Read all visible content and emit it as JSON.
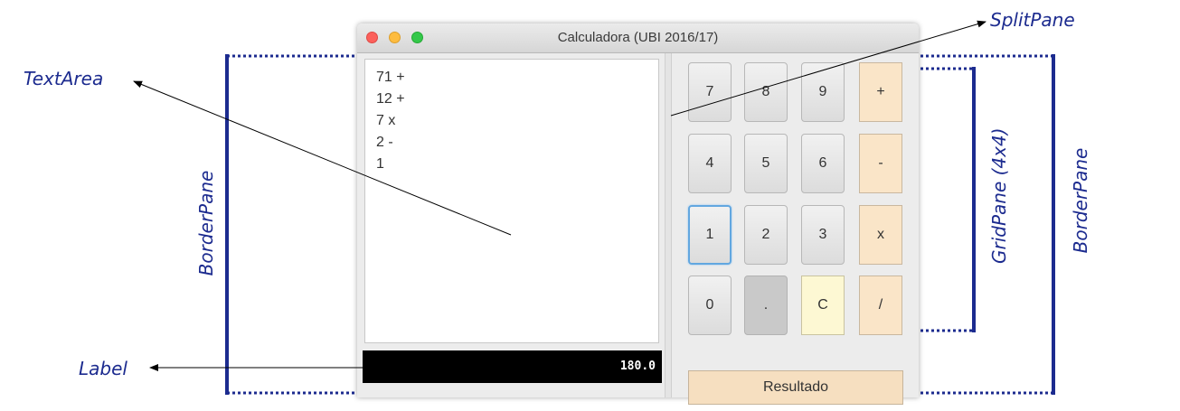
{
  "annotations": {
    "split_pane": "SplitPane",
    "text_area": "TextArea",
    "label": "Label",
    "border_pane_left": "BorderPane",
    "grid_pane": "GridPane (4x4)",
    "border_pane_right": "BorderPane"
  },
  "window": {
    "title": "Calculadora  (UBI 2016/17)",
    "traffic_lights": {
      "close": "#fc605b",
      "minimize": "#fdbc40",
      "zoom": "#34c84a"
    }
  },
  "text_area": {
    "lines": [
      "71 +",
      "12 +",
      "7 x",
      "2 -",
      "1"
    ]
  },
  "result_label": "180.0",
  "keypad": {
    "rows": [
      [
        "7",
        "8",
        "9",
        "+"
      ],
      [
        "4",
        "5",
        "6",
        "-"
      ],
      [
        "1",
        "2",
        "3",
        "x"
      ],
      [
        "0",
        ".",
        "C",
        "/"
      ]
    ]
  },
  "resultado_button": "Resultado",
  "colors": {
    "annotation": "#1c2b8f",
    "operator_key": "#fae5c8",
    "clear_key": "#fdf8d3",
    "resultado": "#f6dfc0",
    "label_bg": "#000000"
  }
}
